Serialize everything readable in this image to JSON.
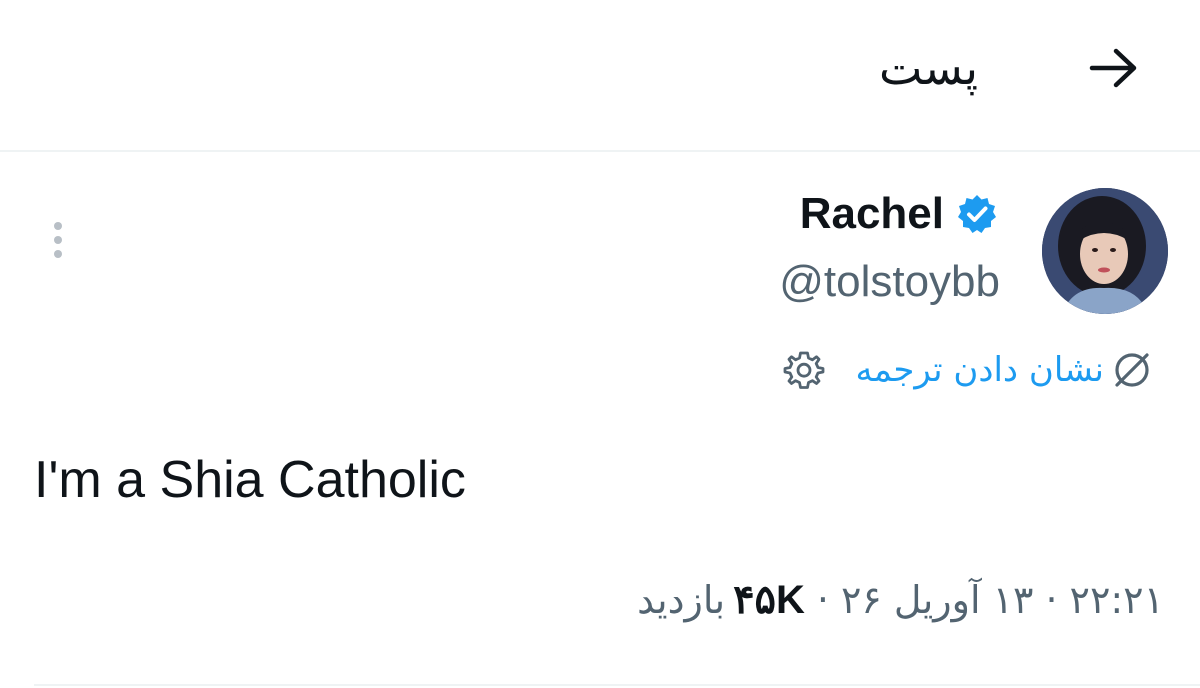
{
  "header": {
    "title": "پست",
    "back_icon": "arrow-right-icon"
  },
  "author": {
    "name": "Rachel",
    "handle": "@tolstoybb",
    "verified": true,
    "verified_color": "#1d9bf0",
    "avatar_icon": "avatar-photo"
  },
  "translate": {
    "label": "نشان دادن ترجمه",
    "icon": "translate-icon",
    "settings_icon": "gear-icon",
    "color": "#1d9bf0"
  },
  "tweet": {
    "text": "I'm a Shia Catholic"
  },
  "meta": {
    "time": "۲۲:۲۱",
    "date": "۱۳ آوریل ۲۶",
    "separator": "·",
    "views_count": "۴۵K",
    "views_label": "بازدید"
  },
  "colors": {
    "primary_text": "#0f1419",
    "secondary_text": "#536471",
    "accent": "#1d9bf0",
    "divider": "#eff3f4"
  }
}
